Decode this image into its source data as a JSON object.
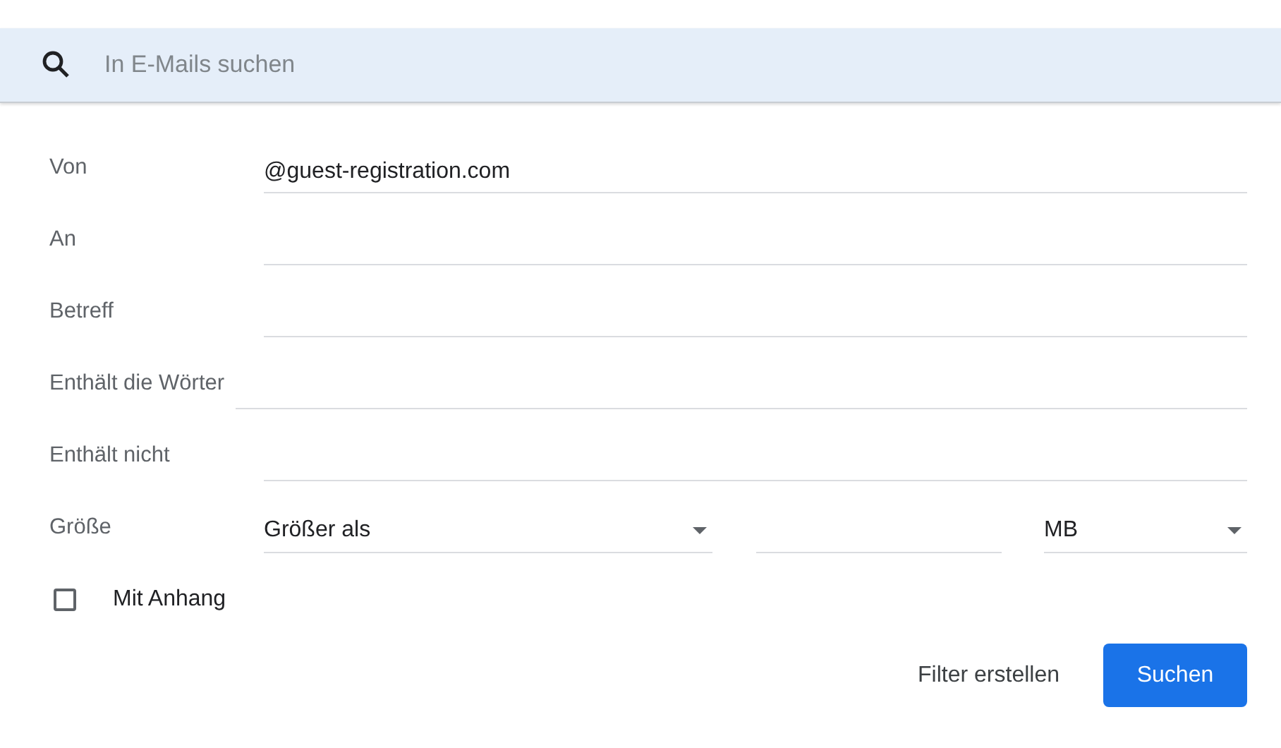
{
  "search": {
    "placeholder": "In E-Mails suchen"
  },
  "fields": [
    {
      "label": "Von",
      "value": "@guest-registration.com"
    },
    {
      "label": "An"
    },
    {
      "label": "Betreff"
    },
    {
      "label": "Enthält die Wörter"
    },
    {
      "label": "Enthält nicht"
    }
  ],
  "size": {
    "label": "Größe",
    "operator": "Größer als",
    "unit": "MB"
  },
  "attachment": {
    "label": "Mit Anhang",
    "checked": false
  },
  "buttons": [
    {
      "label": "Filter erstellen",
      "kind": "text"
    },
    {
      "label": "Suchen",
      "kind": "primary"
    }
  ]
}
